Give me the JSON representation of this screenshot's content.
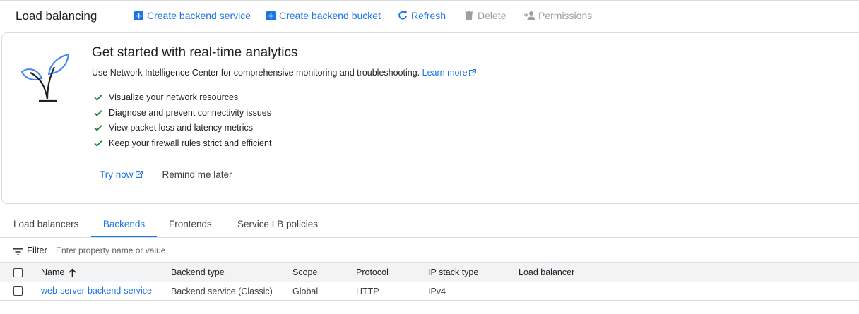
{
  "header": {
    "title": "Load balancing",
    "actions": [
      {
        "label": "Create backend service",
        "icon": "add-box-icon",
        "state": "enabled"
      },
      {
        "label": "Create backend bucket",
        "icon": "add-box-icon",
        "state": "enabled"
      },
      {
        "label": "Refresh",
        "icon": "refresh-icon",
        "state": "enabled"
      },
      {
        "label": "Delete",
        "icon": "trash-icon",
        "state": "disabled"
      },
      {
        "label": "Permissions",
        "icon": "person-add-icon",
        "state": "disabled"
      }
    ]
  },
  "promo": {
    "icon": "plant-icon",
    "title": "Get started with real-time analytics",
    "description": "Use Network Intelligence Center for comprehensive monitoring and troubleshooting.",
    "learn_more": "Learn more",
    "checklist": [
      "Visualize your network resources",
      "Diagnose and prevent connectivity issues",
      "View packet loss and latency metrics",
      "Keep your firewall rules strict and efficient"
    ],
    "try_now": "Try now",
    "remind_later": "Remind me later"
  },
  "tabs": [
    {
      "label": "Load balancers",
      "active": false
    },
    {
      "label": "Backends",
      "active": true
    },
    {
      "label": "Frontends",
      "active": false
    },
    {
      "label": "Service LB policies",
      "active": false
    }
  ],
  "filter": {
    "label": "Filter",
    "placeholder": "Enter property name or value"
  },
  "table": {
    "columns": [
      "Name",
      "Backend type",
      "Scope",
      "Protocol",
      "IP stack type",
      "Load balancer"
    ],
    "sort_column": "Name",
    "sort_direction": "ascending",
    "rows": [
      {
        "name": "web-server-backend-service",
        "backend_type": "Backend service (Classic)",
        "scope": "Global",
        "protocol": "HTTP",
        "ip_stack_type": "IPv4",
        "load_balancer": ""
      }
    ]
  },
  "colors": {
    "accent": "#1a73e8",
    "check": "#188038",
    "disabled": "#9aa0a6",
    "border": "#dadce0",
    "header_bg": "#f1f3f4"
  }
}
